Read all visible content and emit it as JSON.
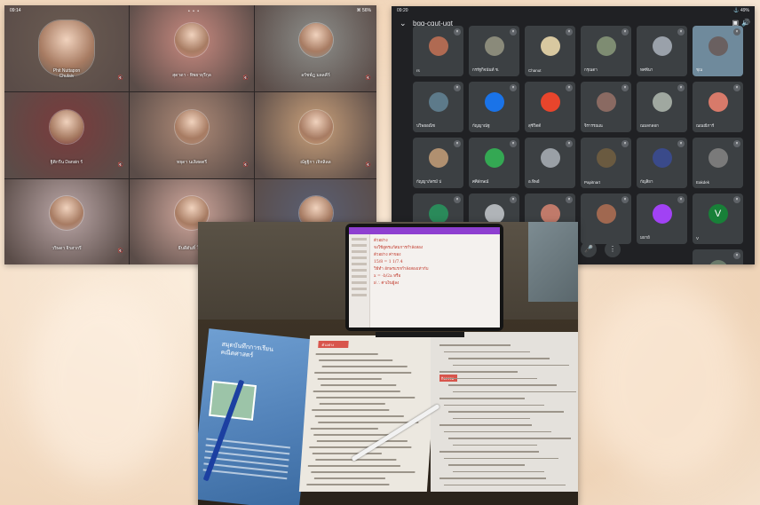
{
  "left_meet": {
    "status_time": "09:14",
    "status_right": "⌘ 56%",
    "pager_dots": "• • •",
    "tiles": [
      {
        "name": "Phit Nuttapon\nChulaiv",
        "color": "#6b5c52"
      },
      {
        "name": "สุดาดา - ทิพยาธุรีกุล",
        "color": "#c98a80"
      },
      {
        "name": "อรัชพ์ฎ มลลคีร์",
        "color": "#8d8e8a"
      },
      {
        "name": "ฐิติกรีน Dansin รั",
        "color": "#7a3b3c"
      },
      {
        "name": "ทยุดา นเลิสดตรี",
        "color": "#ae8a77"
      },
      {
        "name": "ณัฐฐิกา เจิทลิลล",
        "color": "#c9a07a"
      },
      {
        "name": "วริษดา จิรสากรี",
        "color": "#bba7a7"
      },
      {
        "name": "ธีบดีตันทิ์ ใสเร",
        "color": "#d1a89d"
      },
      {
        "name": "",
        "color": "#5a5f73"
      }
    ]
  },
  "right_meet": {
    "status_time": "09:20",
    "status_right": "⚓ 49%",
    "meeting_code": "bgq-cqut-ugt",
    "tiles": [
      {
        "name": "rs",
        "initial": "",
        "avatar_color": "#b06a52"
      },
      {
        "name": "กรรัฐกิจนันท์ ช.",
        "initial": "",
        "avatar_color": "#8a8a7a"
      },
      {
        "name": "Chanut",
        "initial": "",
        "avatar_color": "#d8c8a0"
      },
      {
        "name": "กรุณดา",
        "initial": "",
        "avatar_color": "#7e8c72"
      },
      {
        "name": "ทศพีนา",
        "initial": "",
        "avatar_color": "#9aa1aa"
      },
      {
        "name": "ชุณ",
        "initial": "",
        "avatar_color": "#6a6060"
      },
      {
        "name": "ปวิพยอณิช",
        "initial": "",
        "avatar_color": "#5d7a8a"
      },
      {
        "name": "กัญญาณัฐ",
        "initial": "",
        "avatar_color": "#1a73e8"
      },
      {
        "name": "สุชีวิตต์",
        "initial": "",
        "avatar_color": "#e8452c"
      },
      {
        "name": "จิรารรณณ",
        "initial": "",
        "avatar_color": "#8a6a62"
      },
      {
        "name": "ณมลกลอก",
        "initial": "",
        "avatar_color": "#a0a8a0"
      },
      {
        "name": "ณณณีการ์",
        "initial": "",
        "avatar_color": "#d87a6a"
      },
      {
        "name": "กัญญาภัสรม์ ป",
        "initial": "",
        "avatar_color": "#b09070"
      },
      {
        "name": "ศศิลักษณ์",
        "initial": "",
        "avatar_color": "#34a853"
      },
      {
        "name": "อ.ทิพย์",
        "initial": "",
        "avatar_color": "#9aa0a6"
      },
      {
        "name": "Papitnart",
        "initial": "",
        "avatar_color": "#6a5a40"
      },
      {
        "name": "กัญสิยา",
        "initial": "",
        "avatar_color": "#3a4a8a"
      },
      {
        "name": "Eakdek",
        "initial": "",
        "avatar_color": "#7a7a7a"
      },
      {
        "name": "",
        "initial": "",
        "avatar_color": "#2a8a5a"
      },
      {
        "name": "",
        "initial": "",
        "avatar_color": "#b0b4b8"
      },
      {
        "name": "",
        "initial": "",
        "avatar_color": "#c07a6a"
      },
      {
        "name": "",
        "initial": "",
        "avatar_color": "#a06850"
      },
      {
        "name": "มยาย์",
        "initial": "",
        "avatar_color": "#a142f4"
      },
      {
        "name": "V",
        "initial": "V",
        "avatar_color": "#188038"
      },
      {
        "name": "ชายนนท์",
        "initial": "",
        "avatar_color": "#6a7a6a"
      }
    ]
  },
  "photo": {
    "booklet_title": "สมุดบันทึกการเรียน\nคณิตศาสตร์",
    "tablet_lines": [
      "ตัวอย่าง",
      "จงใช้สูตรแก้สมการกำลังสอง",
      "ตัวอย่าง  ค่าของ",
      "15/8  = 1 1/7.4",
      "วิธีทำ   อักษรแรกกำลังสองเท่ากับ",
      "x = -b/2a  หรือ",
      "ฝ ∴  ค่าเงินผู้ลง"
    ],
    "book_header_left": "ตัวอย่าง",
    "book_header_right": "กิจกรรม"
  }
}
